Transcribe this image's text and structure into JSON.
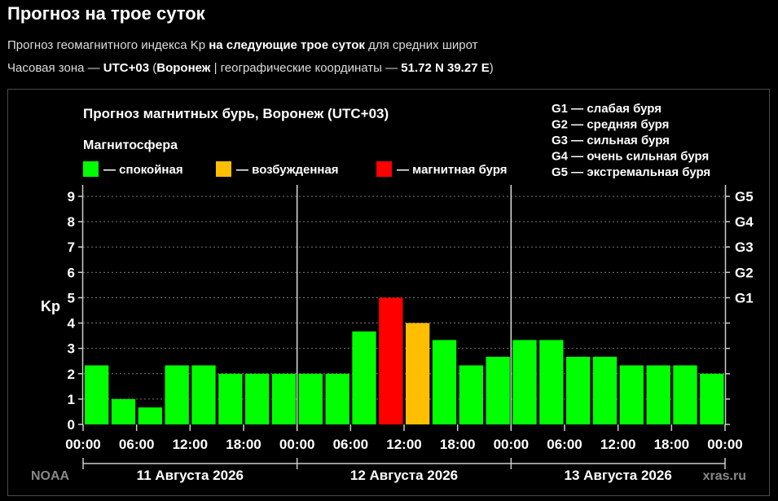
{
  "header": {
    "title": "Прогноз на трое суток",
    "line1_pre": "Прогноз геомагнитного индекса Kp ",
    "line1_bold": "на следующие трое суток",
    "line1_post": " для средних широт",
    "line2_pre": "Часовая зона — ",
    "line2_tz": "UTC+03",
    "line2_mid1": " (",
    "line2_city": "Воронеж",
    "line2_mid2": " | географические координаты — ",
    "line2_coords": "51.72 N 39.27 E",
    "line2_post": ")"
  },
  "chart_data": {
    "type": "bar",
    "title": "Прогноз магнитных бурь, Воронеж (UTC+03)",
    "legend_title": "Магнитосфера",
    "legend": [
      {
        "key": "calm",
        "label": "— спокойная",
        "color": "#00ff00"
      },
      {
        "key": "excited",
        "label": "— возбужденная",
        "color": "#ffbf00"
      },
      {
        "key": "storm",
        "label": "— магнитная буря",
        "color": "#ff0000"
      }
    ],
    "g_legend": [
      "G1 — слабая буря",
      "G2 — средняя буря",
      "G3 — сильная буря",
      "G4 — очень сильная буря",
      "G5 — экстремальная буря"
    ],
    "ylabel": "Kp",
    "ylim": [
      0,
      9
    ],
    "yticks": [
      "0",
      "1",
      "2",
      "3",
      "4",
      "5",
      "6",
      "7",
      "8",
      "9"
    ],
    "right_ticks": [
      {
        "value": 5,
        "label": "G1"
      },
      {
        "value": 6,
        "label": "G2"
      },
      {
        "value": 7,
        "label": "G3"
      },
      {
        "value": 8,
        "label": "G4"
      },
      {
        "value": 9,
        "label": "G5"
      }
    ],
    "xticks": [
      "00:00",
      "06:00",
      "12:00",
      "18:00",
      "00:00",
      "06:00",
      "12:00",
      "18:00",
      "00:00",
      "06:00",
      "12:00",
      "18:00",
      "00:00"
    ],
    "days": [
      "11 Августа 2026",
      "12 Августа 2026",
      "13 Августа 2026"
    ],
    "values": [
      2.33,
      1.0,
      0.67,
      2.33,
      2.33,
      2.0,
      2.0,
      2.0,
      2.0,
      2.0,
      3.67,
      5.0,
      4.0,
      3.33,
      2.33,
      2.67,
      3.33,
      3.33,
      2.67,
      2.67,
      2.33,
      2.33,
      2.33,
      2.0
    ],
    "grid": true,
    "legend_position": "top"
  },
  "watermarks": {
    "left": "NOAA",
    "right": "xras.ru"
  }
}
